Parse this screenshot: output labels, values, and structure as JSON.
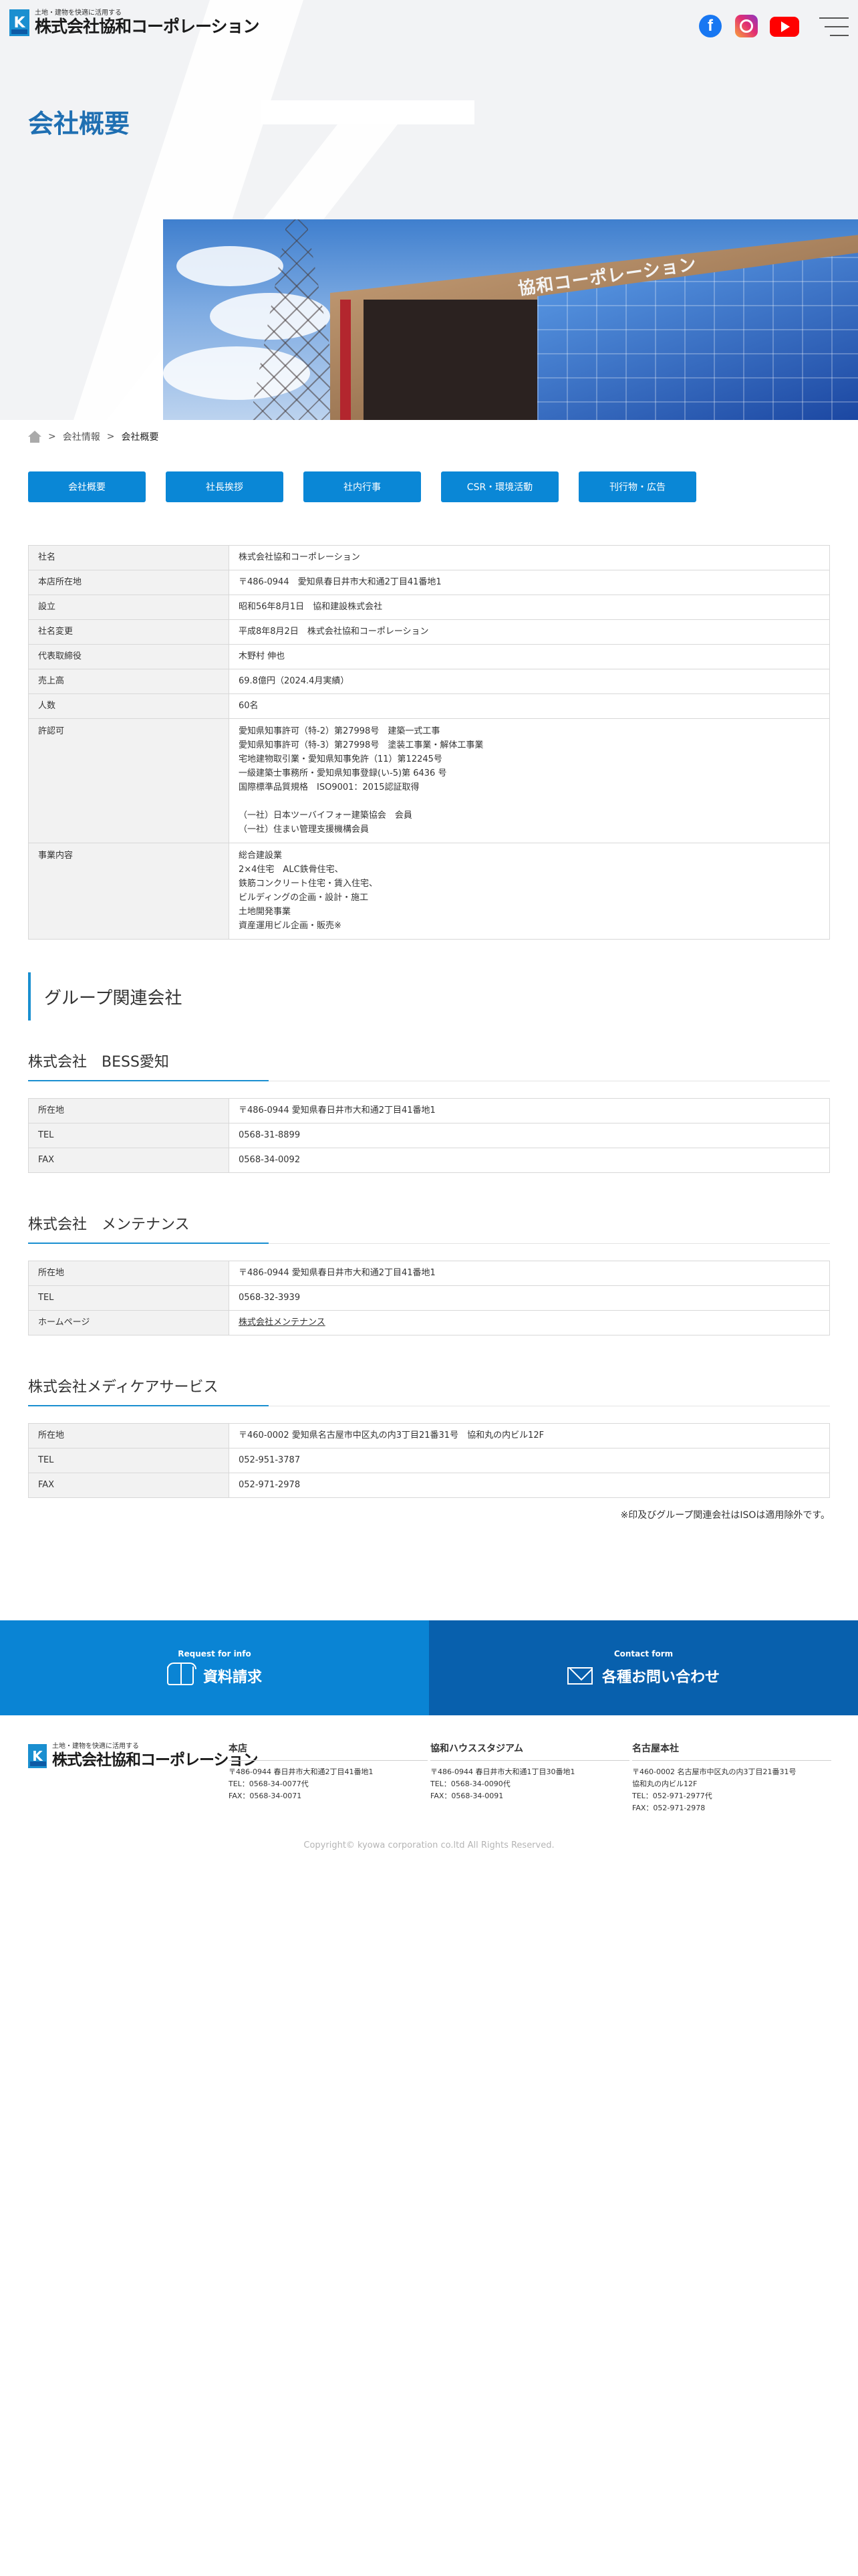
{
  "header": {
    "logo_tagline": "土地・建物を快適に活用する",
    "logo_name": "株式会社協和コーポレーション",
    "logo_mark": "K",
    "social": [
      "facebook-icon",
      "instagram-icon",
      "youtube-icon"
    ]
  },
  "page_title": "会社概要",
  "breadcrumb": [
    "会社情報",
    "会社概要"
  ],
  "photo_sign": "協和コーポレーション",
  "tabs": [
    "会社概要",
    "社長挨拶",
    "社内行事",
    "CSR・環境活動",
    "刊行物・広告"
  ],
  "profile": [
    {
      "key": "社名",
      "value": [
        "株式会社協和コーポレーション"
      ]
    },
    {
      "key": "本店所在地",
      "value": [
        "〒486-0944　愛知県春日井市大和通2丁目41番地1"
      ]
    },
    {
      "key": "設立",
      "value": [
        "昭和56年8月1日　協和建設株式会社"
      ]
    },
    {
      "key": "社名変更",
      "value": [
        "平成8年8月2日　株式会社協和コーポレーション"
      ]
    },
    {
      "key": "代表取締役",
      "value": [
        "木野村 伸也"
      ]
    },
    {
      "key": "売上高",
      "value": [
        "69.8億円（2024.4月実績）"
      ]
    },
    {
      "key": "人数",
      "value": [
        "60名"
      ]
    },
    {
      "key": "許認可",
      "value": [
        "愛知県知事許可（特-2）第27998号　建築一式工事",
        "愛知県知事許可（特-3）第27998号　塗装工事業・解体工事業",
        "宅地建物取引業・愛知県知事免許（11）第12245号",
        "一級建築士事務所・愛知県知事登録(い-5)第 6436 号",
        "国際標準品質規格　ISO9001：2015認証取得",
        "",
        "（一社）日本ツーバイフォー建築協会　会員",
        "（一社）住まい管理支援機構会員"
      ]
    },
    {
      "key": "事業内容",
      "value": [
        "総合建設業",
        "2×4住宅　ALC鉄骨住宅、",
        "鉄筋コンクリート住宅・賃入住宅、",
        "ビルディングの企画・設計・施工",
        "土地開発事業",
        "資産運用ビル企画・販売※"
      ]
    }
  ],
  "group_title": "グループ関連会社",
  "companies": [
    {
      "name": "株式会社　BESS愛知",
      "rows": [
        {
          "key": "所在地",
          "value": "〒486-0944 愛知県春日井市大和通2丁目41番地1"
        },
        {
          "key": "TEL",
          "value": "0568-31-8899"
        },
        {
          "key": "FAX",
          "value": "0568-34-0092"
        }
      ]
    },
    {
      "name": "株式会社　メンテナンス",
      "rows": [
        {
          "key": "所在地",
          "value": "〒486-0944 愛知県春日井市大和通2丁目41番地1"
        },
        {
          "key": "TEL",
          "value": "0568-32-3939"
        },
        {
          "key": "ホームページ",
          "value": "株式会社メンテナンス"
        }
      ]
    },
    {
      "name": "株式会社メディケアサービス",
      "rows": [
        {
          "key": "所在地",
          "value": "〒460-0002 愛知県名古屋市中区丸の内3丁目21番31号　協和丸の内ビル12F"
        },
        {
          "key": "TEL",
          "value": "052-951-3787"
        },
        {
          "key": "FAX",
          "value": "052-971-2978"
        }
      ]
    }
  ],
  "iso_note": "※印及びグループ関連会社はISOは適用除外です。",
  "cta": {
    "request_sub": "Request for info",
    "request_main": "資料請求",
    "contact_sub": "Contact form",
    "contact_main": "各種お問い合わせ"
  },
  "offices": [
    {
      "name": "本店",
      "lines": [
        "〒486-0944 春日井市大和通2丁目41番地1",
        "TEL：0568-34-0077代",
        "FAX：0568-34-0071"
      ]
    },
    {
      "name": "協和ハウススタジアム",
      "lines": [
        "〒486-0944 春日井市大和通1丁目30番地1",
        "TEL：0568-34-0090代",
        "FAX：0568-34-0091"
      ]
    },
    {
      "name": "名古屋本社",
      "lines": [
        "〒460-0002 名古屋市中区丸の内3丁目21番31号",
        "協和丸の内ビル12F",
        "TEL：052-971-2977代",
        "FAX：052-971-2978"
      ]
    }
  ],
  "copyright": "Copyright© kyowa corporation co.ltd All Rights Reserved.",
  "colors": {
    "accent": "#0a87d6",
    "title": "#1f6fb2",
    "cta_left": "#0a84d4",
    "cta_right": "#0860ad"
  }
}
